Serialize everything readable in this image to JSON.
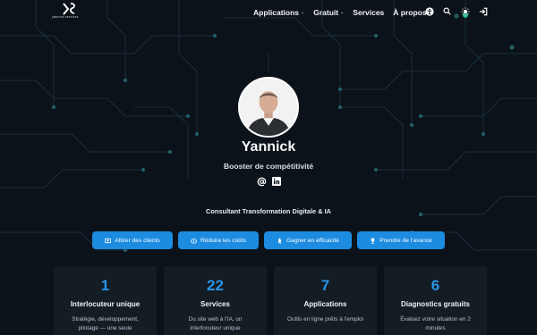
{
  "brand": {
    "logo_text": "yannick services"
  },
  "nav": {
    "items": [
      {
        "label": "Applications",
        "has_dropdown": true
      },
      {
        "label": "Gratuit",
        "has_dropdown": true
      },
      {
        "label": "Services",
        "has_dropdown": false
      },
      {
        "label": "À propos",
        "has_dropdown": true
      }
    ],
    "icons": [
      "accessibility-icon",
      "search-icon",
      "theme-toggle-icon",
      "login-icon"
    ]
  },
  "profile": {
    "name": "Yannick",
    "tagline": "Booster de compétitivité",
    "social": [
      "email-at-icon",
      "linkedin-icon"
    ],
    "role": "Consultant Transformation Digitale & IA"
  },
  "cta": [
    {
      "label": "Attirer des clients",
      "icon": "users-icon"
    },
    {
      "label": "Réduire les coûts",
      "icon": "savings-icon"
    },
    {
      "label": "Gagner en efficacité",
      "icon": "rocket-icon"
    },
    {
      "label": "Prendre de l'avance",
      "icon": "trophy-icon"
    }
  ],
  "stats": [
    {
      "number": "1",
      "title": "Interlocuteur unique",
      "desc": "Stratégie, développement, pilotage — une seule"
    },
    {
      "number": "22",
      "title": "Services",
      "desc": "Du site web à l'IA, un interlocuteur unique"
    },
    {
      "number": "7",
      "title": "Applications",
      "desc": "Outils en ligne prêts à l'emploi"
    },
    {
      "number": "6",
      "title": "Diagnostics gratuits",
      "desc": "Évaluez votre situation en 2 minutes"
    }
  ],
  "colors": {
    "background": "#0c1219",
    "accent": "#1c8be0",
    "number": "#2a95e8",
    "card": "#141c24"
  }
}
